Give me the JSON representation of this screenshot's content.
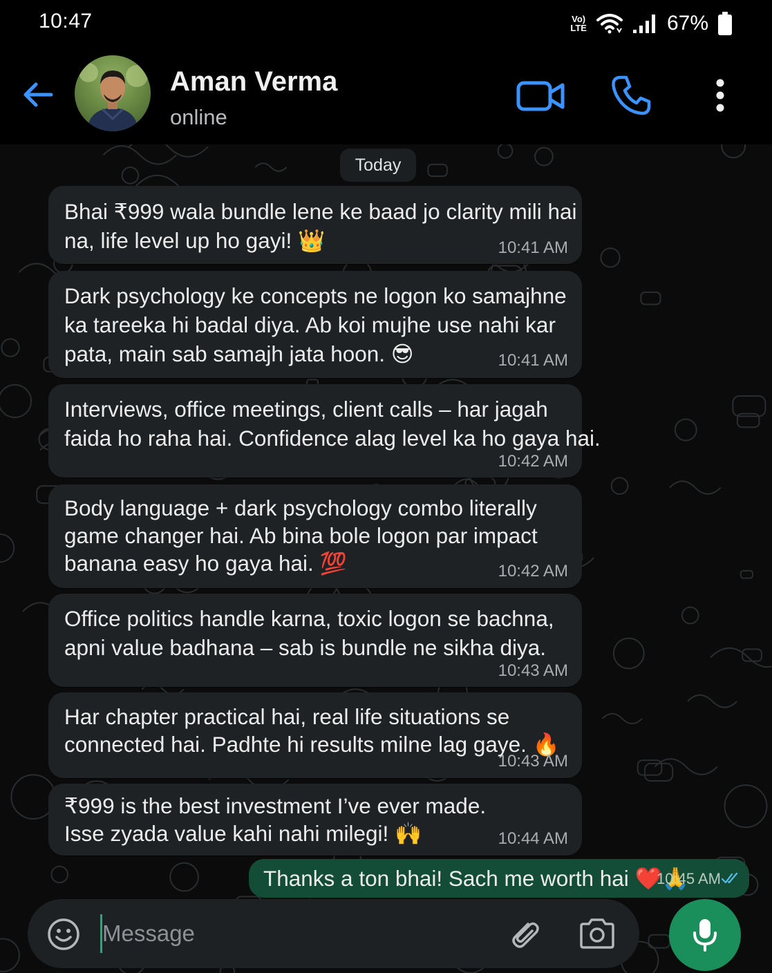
{
  "status_bar": {
    "time": "10:47",
    "network_label": "Vo) LTE",
    "battery_percent": "67%",
    "icons": [
      "wifi-icon",
      "signal-icon",
      "battery-icon"
    ]
  },
  "header": {
    "contact_name": "Aman Verma",
    "status": "online",
    "icons": [
      "back-arrow-icon",
      "video-call-icon",
      "phone-icon",
      "more-vertical-icon"
    ],
    "accent_color": "#3b93ff"
  },
  "chat": {
    "date_chip": "Today",
    "incoming": [
      {
        "lines": [
          "Bhai ₹999 wala bundle lene ke baad jo clarity mili hai",
          "na, life level up ho gayi! 👑"
        ],
        "time": "10:41 AM"
      },
      {
        "lines": [
          "Dark psychology ke concepts ne logon ko samajhne",
          "ka tareeka hi badal diya. Ab koi mujhe use nahi kar",
          "pata, main sab samajh jata hoon. 😎"
        ],
        "time": "10:41 AM"
      },
      {
        "lines": [
          "Interviews, office meetings, client calls – har jagah",
          "faida ho raha hai. Confidence alag level ka ho gaya hai."
        ],
        "time": "10:42 AM"
      },
      {
        "lines": [
          "Body language + dark psychology combo literally",
          "game changer hai. Ab bina bole logon par impact",
          "banana easy ho gaya hai. 💯"
        ],
        "time": "10:42 AM"
      },
      {
        "lines": [
          "Office politics handle karna, toxic logon se bachna,",
          "apni value badhana – sab is bundle ne sikha diya."
        ],
        "time": "10:43 AM"
      },
      {
        "lines": [
          "Har chapter practical hai, real life situations se",
          "connected hai. Padhte hi results milne lag gaye. 🔥"
        ],
        "time": "10:43 AM"
      },
      {
        "lines": [
          "₹999 is the best investment I’ve ever made.",
          "Isse zyada value kahi nahi milegi! 🙌"
        ],
        "time": "10:44 AM"
      }
    ],
    "outgoing": {
      "text": "Thanks a ton bhai! Sach me worth hai ❤️🙏",
      "time": "10:45 AM",
      "status_icon": "double-check-icon"
    },
    "colors": {
      "incoming_bubble": "#1f2225",
      "outgoing_bubble": "#144d37",
      "read_ticks": "#53bdeb"
    }
  },
  "input_bar": {
    "placeholder": "Message",
    "icons": [
      "emoji-icon",
      "paperclip-icon",
      "camera-icon",
      "microphone-icon"
    ],
    "mic_color": "#1a8f5b"
  }
}
